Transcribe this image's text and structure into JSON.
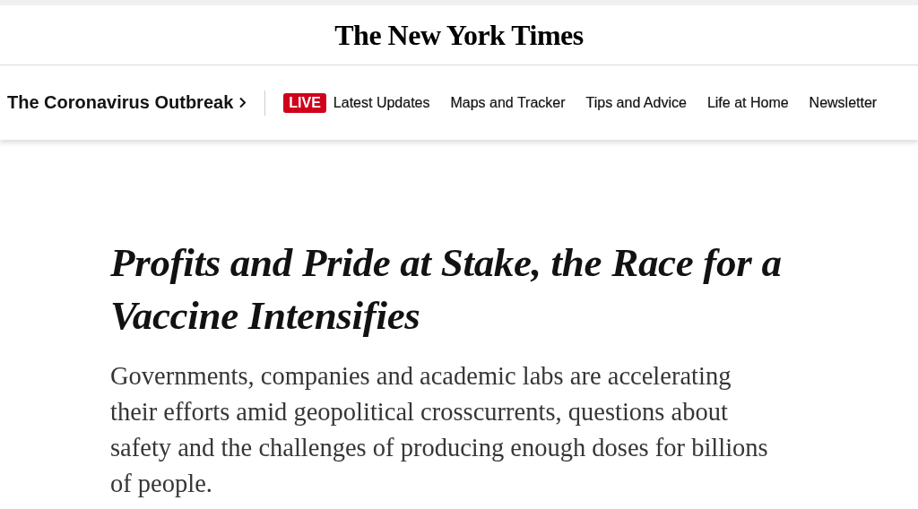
{
  "masthead": {
    "logo": "The New York Times"
  },
  "section_nav": {
    "title": "The Coronavirus Outbreak",
    "items": [
      {
        "label": "Latest Updates",
        "badge": "LIVE"
      },
      {
        "label": "Maps and Tracker"
      },
      {
        "label": "Tips and Advice"
      },
      {
        "label": "Life at Home"
      },
      {
        "label": "Newsletter"
      }
    ]
  },
  "article": {
    "headline": "Profits and Pride at Stake, the Race for a Vaccine Intensifies",
    "summary": "Governments, companies and academic labs are accelerating their efforts amid geopolitical crosscurrents, questions about safety and the challenges of producing enough doses for billions of people."
  }
}
